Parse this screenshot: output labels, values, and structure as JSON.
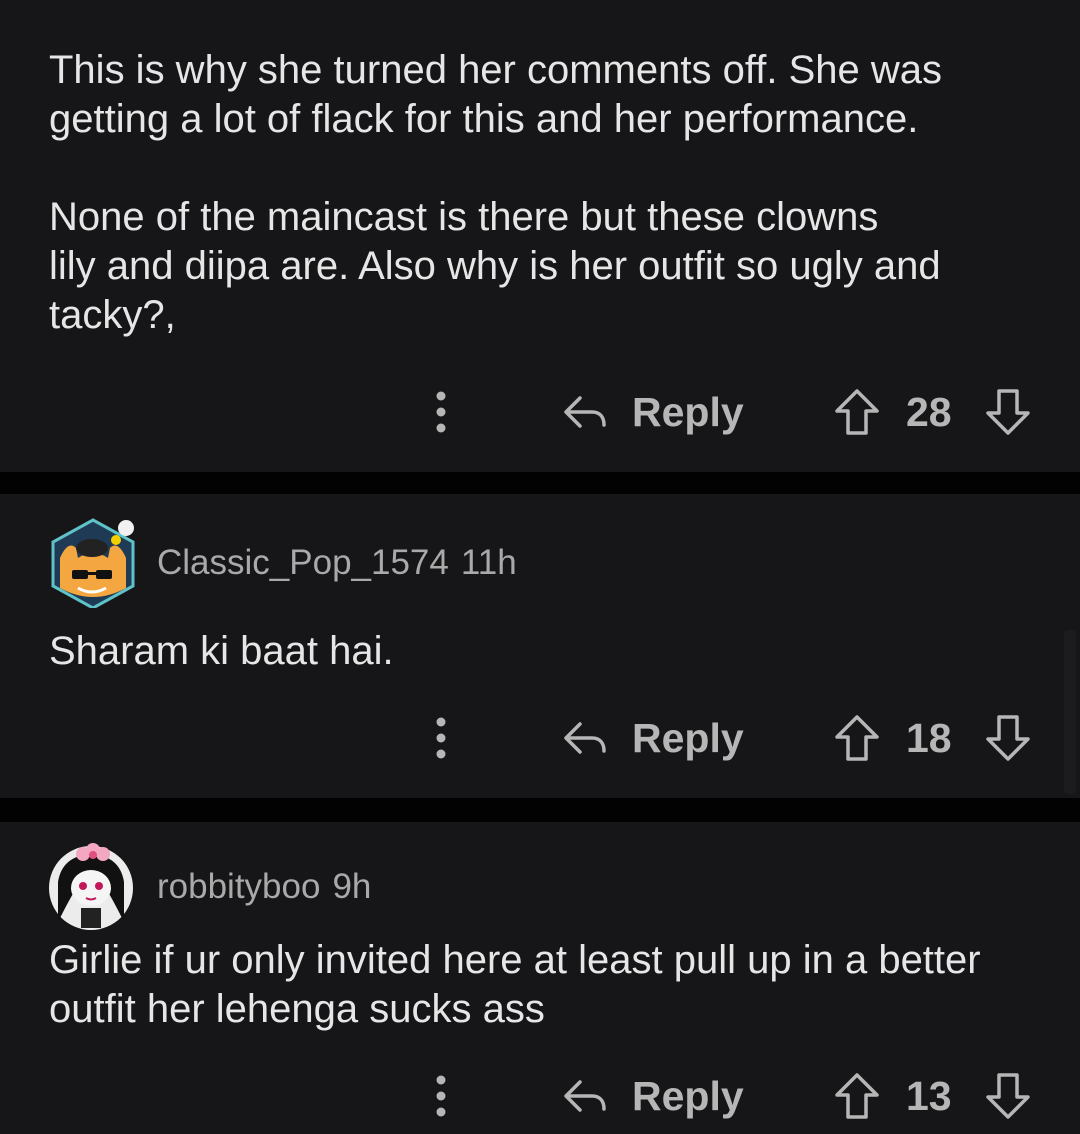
{
  "comments": [
    {
      "body": "This is why she turned her comments off. She was\ngetting a lot of flack for this and her performance.\n\nNone of the maincast is there but these clowns\nlily and diipa are. Also why is her outfit so ugly and\ntacky?,",
      "reply_label": "Reply",
      "votes": "28"
    },
    {
      "username": "Classic_Pop_1574",
      "age": "11h",
      "avatar_icon": "cat-sunglasses-avatar-icon",
      "body": "Sharam ki baat hai.",
      "reply_label": "Reply",
      "votes": "18"
    },
    {
      "username": "robbityboo",
      "age": "9h",
      "avatar_icon": "girl-flower-avatar-icon",
      "body": "Girlie if ur only invited here at least pull up in a better\noutfit her lehenga sucks ass",
      "reply_label": "Reply",
      "votes": "13"
    }
  ],
  "colors": {
    "background": "#020202",
    "card": "#161618",
    "body_text": "#e6e6e6",
    "meta_text": "#a9a9a9",
    "action_text": "#b6b6b6"
  }
}
